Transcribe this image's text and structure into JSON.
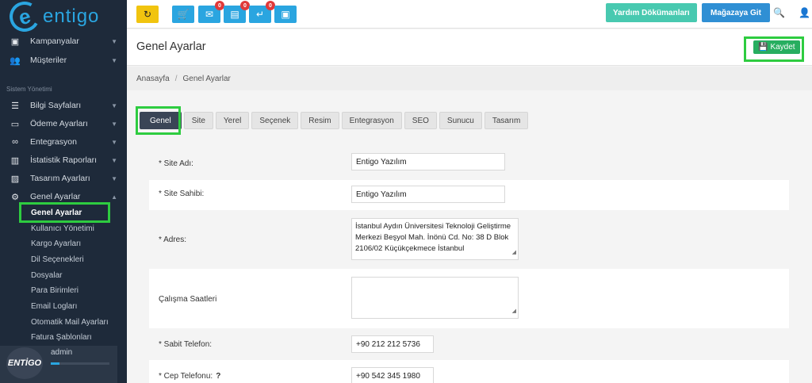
{
  "brand": {
    "logo_letter": "e",
    "logo_text": "entigo"
  },
  "sidebar": {
    "items_top": [
      {
        "icon": "briefcase-icon",
        "glyph": "▣",
        "label": "Kampanyalar"
      },
      {
        "icon": "users-icon",
        "glyph": "👥",
        "label": "Müşteriler"
      }
    ],
    "section_label": "Sistem Yönetimi",
    "items": [
      {
        "icon": "list-icon",
        "glyph": "☰",
        "label": "Bilgi Sayfaları"
      },
      {
        "icon": "card-icon",
        "glyph": "▭",
        "label": "Ödeme Ayarları"
      },
      {
        "icon": "link-icon",
        "glyph": "∞",
        "label": "Entegrasyon"
      },
      {
        "icon": "chart-icon",
        "glyph": "▥",
        "label": "İstatistik Raporları"
      },
      {
        "icon": "image-icon",
        "glyph": "▨",
        "label": "Tasarım Ayarları"
      },
      {
        "icon": "gear-icon",
        "glyph": "⚙",
        "label": "Genel Ayarlar"
      }
    ],
    "sub_items": [
      "Genel Ayarlar",
      "Kullanıcı Yönetimi",
      "Kargo Ayarları",
      "Dil Seçenekleri",
      "Dosyalar",
      "Para Birimleri",
      "Email Logları",
      "Otomatik Mail Ayarları",
      "Fatura Şablonları"
    ],
    "user": {
      "avatar_text": "ENTİGO",
      "name": "admin",
      "progress": 0.15
    }
  },
  "topbar": {
    "badges": [
      "0",
      "0",
      "0"
    ],
    "docs_button": "Yardım Dökümanları",
    "store_button": "Mağazaya Git"
  },
  "header": {
    "title": "Genel Ayarlar",
    "save_label": "Kaydet"
  },
  "breadcrumb": {
    "home": "Anasayfa",
    "current": "Genel Ayarlar"
  },
  "tabs": [
    "Genel",
    "Site",
    "Yerel",
    "Seçenek",
    "Resim",
    "Entegrasyon",
    "SEO",
    "Sunucu",
    "Tasarım"
  ],
  "form": {
    "site_name": {
      "label": "* Site Adı:",
      "value": "Entigo Yazılım"
    },
    "site_owner": {
      "label": "* Site Sahibi:",
      "value": "Entigo Yazılım"
    },
    "address": {
      "label": "* Adres:",
      "value": "İstanbul Aydın Üniversitesi Teknoloji Geliştirme Merkezi Beşyol Mah. İnönü Cd. No: 38 D Blok 2106/02 Küçükçekmece İstanbul"
    },
    "hours": {
      "label": "Çalışma Saatleri",
      "value": ""
    },
    "fixed_phone": {
      "label": "* Sabit Telefon:",
      "value": "+90 212 212 5736"
    },
    "mobile_phone": {
      "label": "* Cep Telefonu:",
      "help": "?",
      "value": "+90 542 345 1980"
    }
  }
}
